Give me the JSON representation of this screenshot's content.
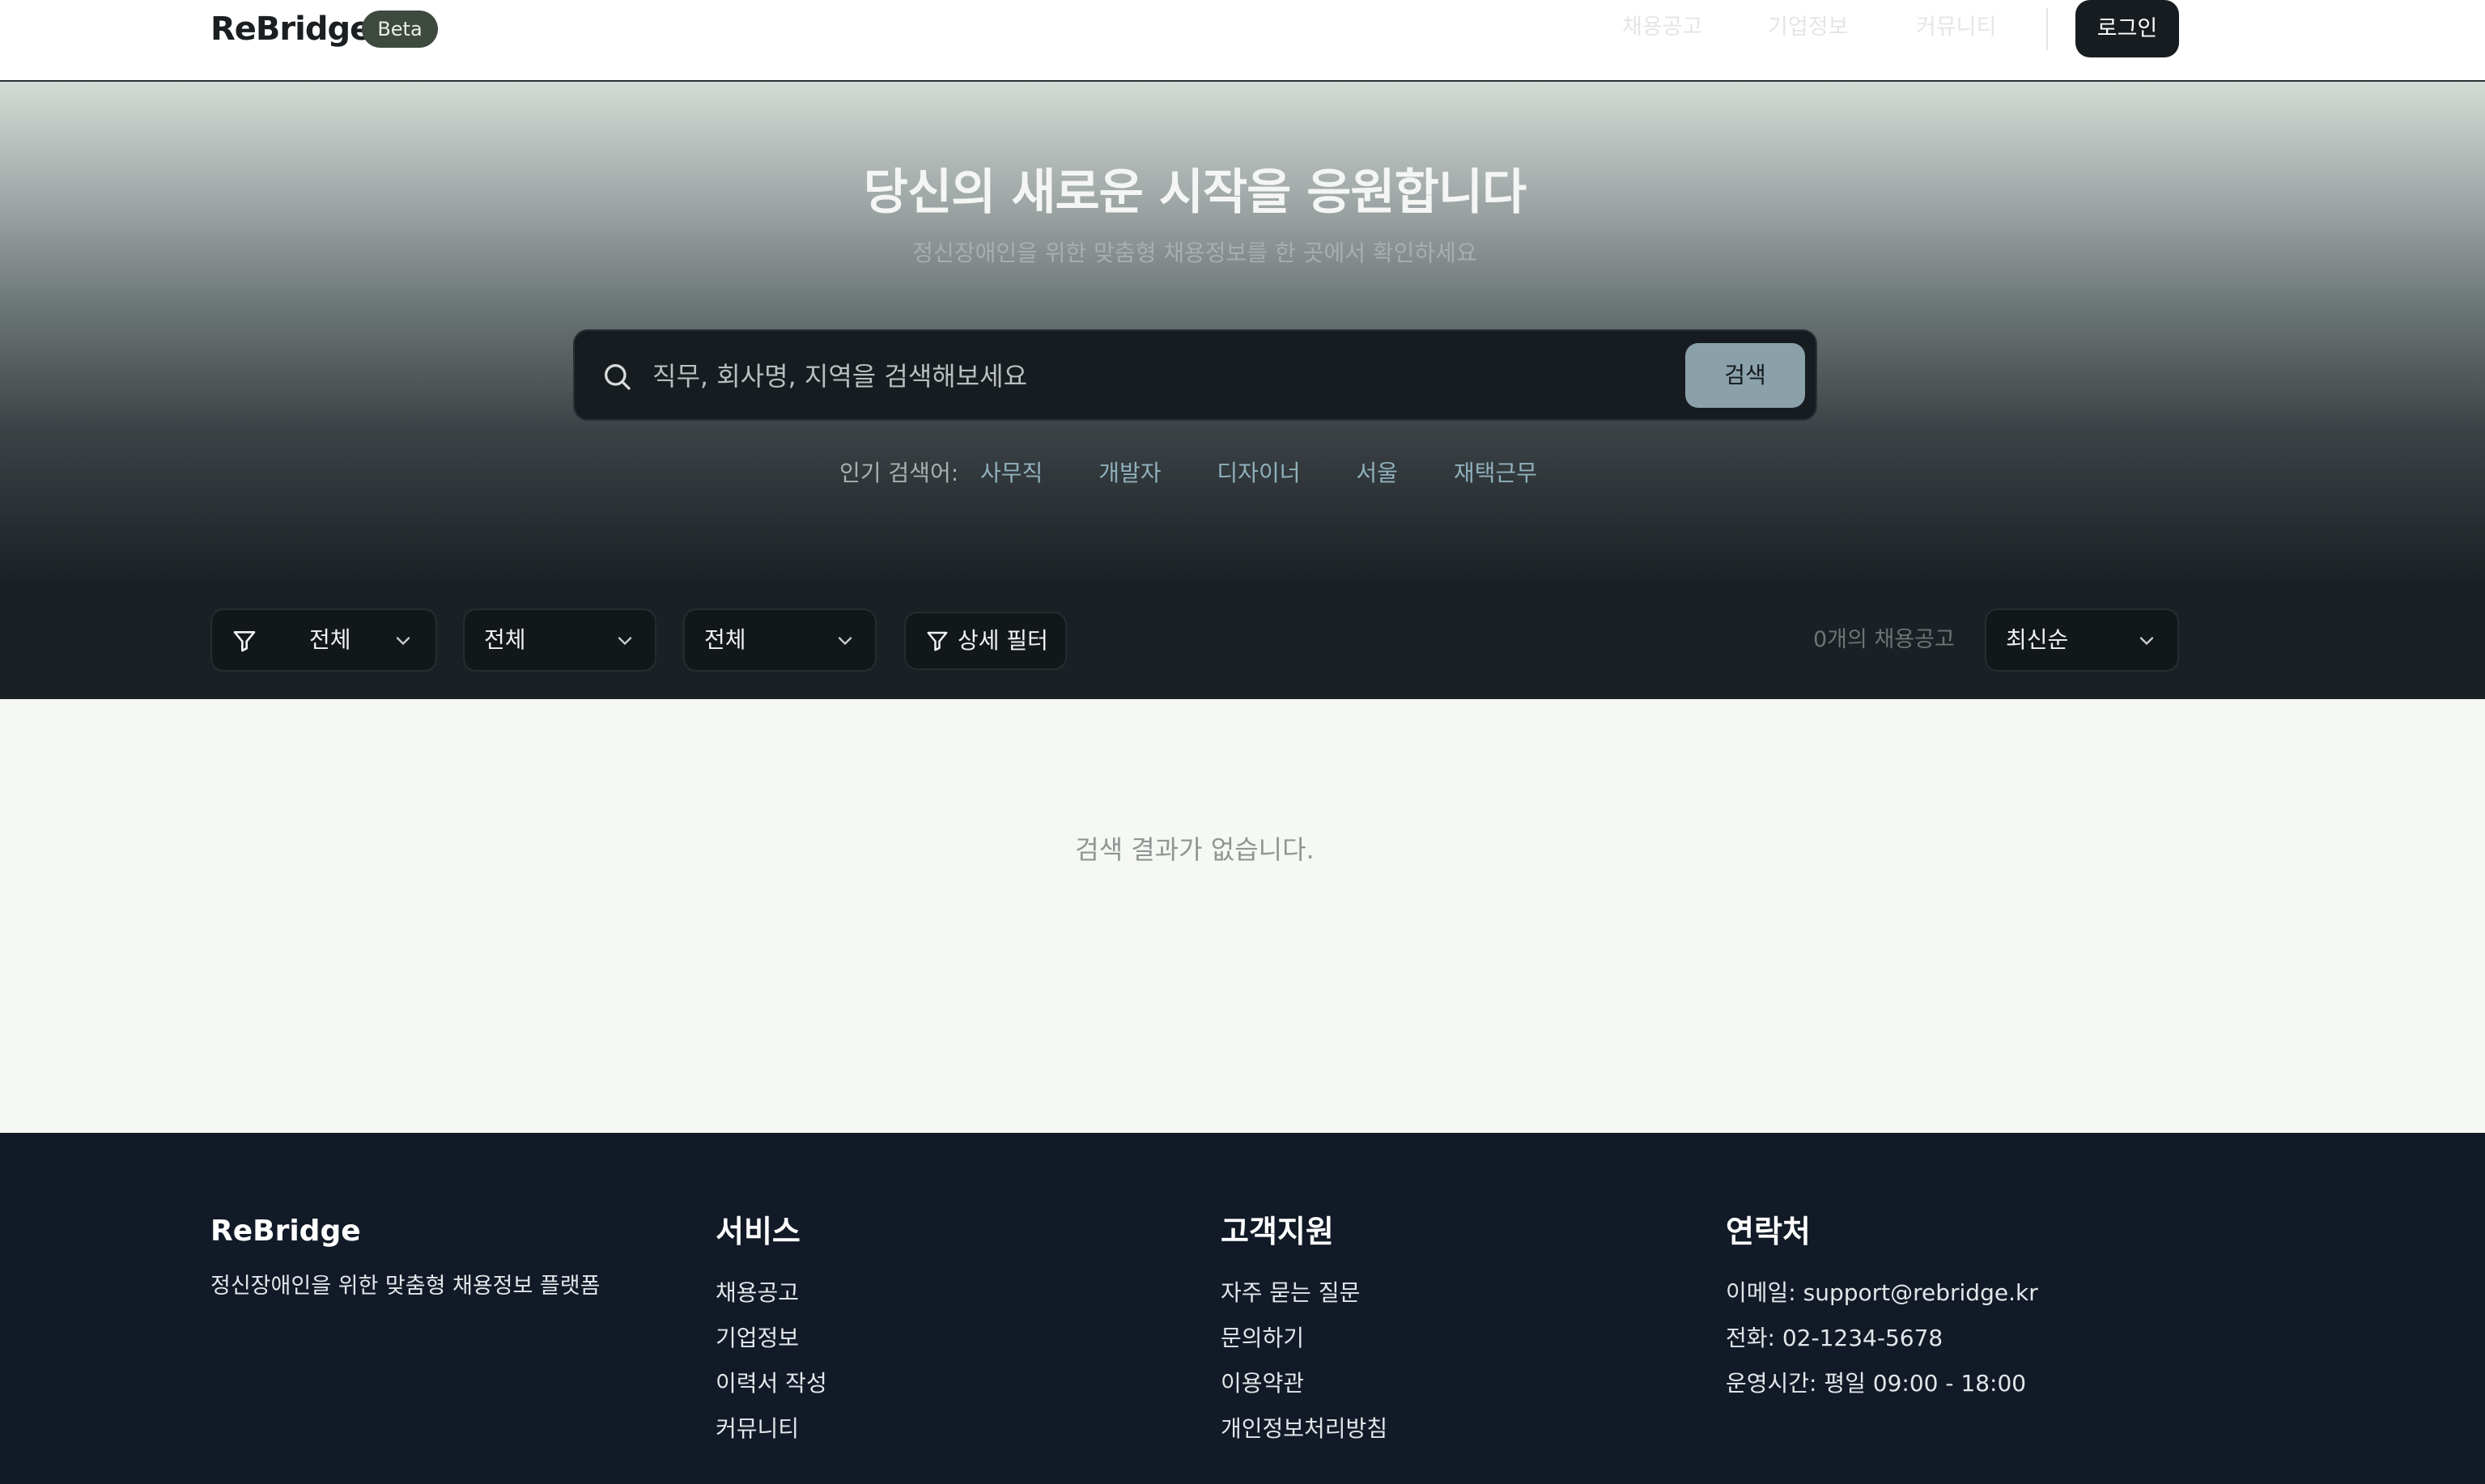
{
  "header": {
    "logo": "ReBridge",
    "badge": "Beta",
    "nav": [
      "채용공고",
      "기업정보",
      "커뮤니티"
    ],
    "login_label": "로그인"
  },
  "hero": {
    "title": "당신의 새로운 시작을 응원합니다",
    "subtitle": "정신장애인을 위한 맞춤형 채용정보를 한 곳에서 확인하세요",
    "search_placeholder": "직무, 회사명, 지역을 검색해보세요",
    "search_button": "검색",
    "popular_label": "인기 검색어:",
    "popular_tags": [
      "사무직",
      "개발자",
      "디자이너",
      "서울",
      "재택근무"
    ]
  },
  "filters": {
    "select1": "전체",
    "select2": "전체",
    "select3": "전체",
    "detail_filter": "상세 필터",
    "count_text": "0개의 채용공고",
    "sort": "최신순"
  },
  "results": {
    "empty_message": "검색 결과가 없습니다."
  },
  "footer": {
    "brand": "ReBridge",
    "description": "정신장애인을 위한 맞춤형 채용정보 플랫폼",
    "services": {
      "title": "서비스",
      "links": [
        "채용공고",
        "기업정보",
        "이력서 작성",
        "커뮤니티"
      ]
    },
    "support": {
      "title": "고객지원",
      "links": [
        "자주 묻는 질문",
        "문의하기",
        "이용약관",
        "개인정보처리방침"
      ]
    },
    "contact": {
      "title": "연락처",
      "lines": [
        "이메일: support@rebridge.kr",
        "전화: 02-1234-5678",
        "운영시간: 평일 09:00 - 18:00"
      ]
    }
  },
  "colors": {
    "accent": "#8aa1aa",
    "popular_tag": "#8fb0bc",
    "footer_bg": "#111a26",
    "header_button": "#171c20"
  },
  "icons": {
    "search": "search-icon",
    "filter": "filter-icon",
    "chevron": "chevron-down-icon"
  }
}
